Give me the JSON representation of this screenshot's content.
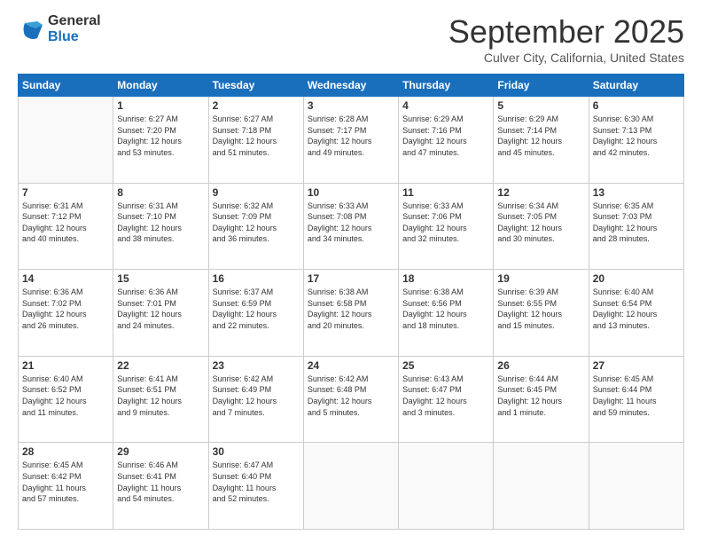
{
  "header": {
    "logo_general": "General",
    "logo_blue": "Blue",
    "month_title": "September 2025",
    "location": "Culver City, California, United States"
  },
  "days_of_week": [
    "Sunday",
    "Monday",
    "Tuesday",
    "Wednesday",
    "Thursday",
    "Friday",
    "Saturday"
  ],
  "weeks": [
    [
      {
        "day": "",
        "info": ""
      },
      {
        "day": "1",
        "info": "Sunrise: 6:27 AM\nSunset: 7:20 PM\nDaylight: 12 hours\nand 53 minutes."
      },
      {
        "day": "2",
        "info": "Sunrise: 6:27 AM\nSunset: 7:18 PM\nDaylight: 12 hours\nand 51 minutes."
      },
      {
        "day": "3",
        "info": "Sunrise: 6:28 AM\nSunset: 7:17 PM\nDaylight: 12 hours\nand 49 minutes."
      },
      {
        "day": "4",
        "info": "Sunrise: 6:29 AM\nSunset: 7:16 PM\nDaylight: 12 hours\nand 47 minutes."
      },
      {
        "day": "5",
        "info": "Sunrise: 6:29 AM\nSunset: 7:14 PM\nDaylight: 12 hours\nand 45 minutes."
      },
      {
        "day": "6",
        "info": "Sunrise: 6:30 AM\nSunset: 7:13 PM\nDaylight: 12 hours\nand 42 minutes."
      }
    ],
    [
      {
        "day": "7",
        "info": "Sunrise: 6:31 AM\nSunset: 7:12 PM\nDaylight: 12 hours\nand 40 minutes."
      },
      {
        "day": "8",
        "info": "Sunrise: 6:31 AM\nSunset: 7:10 PM\nDaylight: 12 hours\nand 38 minutes."
      },
      {
        "day": "9",
        "info": "Sunrise: 6:32 AM\nSunset: 7:09 PM\nDaylight: 12 hours\nand 36 minutes."
      },
      {
        "day": "10",
        "info": "Sunrise: 6:33 AM\nSunset: 7:08 PM\nDaylight: 12 hours\nand 34 minutes."
      },
      {
        "day": "11",
        "info": "Sunrise: 6:33 AM\nSunset: 7:06 PM\nDaylight: 12 hours\nand 32 minutes."
      },
      {
        "day": "12",
        "info": "Sunrise: 6:34 AM\nSunset: 7:05 PM\nDaylight: 12 hours\nand 30 minutes."
      },
      {
        "day": "13",
        "info": "Sunrise: 6:35 AM\nSunset: 7:03 PM\nDaylight: 12 hours\nand 28 minutes."
      }
    ],
    [
      {
        "day": "14",
        "info": "Sunrise: 6:36 AM\nSunset: 7:02 PM\nDaylight: 12 hours\nand 26 minutes."
      },
      {
        "day": "15",
        "info": "Sunrise: 6:36 AM\nSunset: 7:01 PM\nDaylight: 12 hours\nand 24 minutes."
      },
      {
        "day": "16",
        "info": "Sunrise: 6:37 AM\nSunset: 6:59 PM\nDaylight: 12 hours\nand 22 minutes."
      },
      {
        "day": "17",
        "info": "Sunrise: 6:38 AM\nSunset: 6:58 PM\nDaylight: 12 hours\nand 20 minutes."
      },
      {
        "day": "18",
        "info": "Sunrise: 6:38 AM\nSunset: 6:56 PM\nDaylight: 12 hours\nand 18 minutes."
      },
      {
        "day": "19",
        "info": "Sunrise: 6:39 AM\nSunset: 6:55 PM\nDaylight: 12 hours\nand 15 minutes."
      },
      {
        "day": "20",
        "info": "Sunrise: 6:40 AM\nSunset: 6:54 PM\nDaylight: 12 hours\nand 13 minutes."
      }
    ],
    [
      {
        "day": "21",
        "info": "Sunrise: 6:40 AM\nSunset: 6:52 PM\nDaylight: 12 hours\nand 11 minutes."
      },
      {
        "day": "22",
        "info": "Sunrise: 6:41 AM\nSunset: 6:51 PM\nDaylight: 12 hours\nand 9 minutes."
      },
      {
        "day": "23",
        "info": "Sunrise: 6:42 AM\nSunset: 6:49 PM\nDaylight: 12 hours\nand 7 minutes."
      },
      {
        "day": "24",
        "info": "Sunrise: 6:42 AM\nSunset: 6:48 PM\nDaylight: 12 hours\nand 5 minutes."
      },
      {
        "day": "25",
        "info": "Sunrise: 6:43 AM\nSunset: 6:47 PM\nDaylight: 12 hours\nand 3 minutes."
      },
      {
        "day": "26",
        "info": "Sunrise: 6:44 AM\nSunset: 6:45 PM\nDaylight: 12 hours\nand 1 minute."
      },
      {
        "day": "27",
        "info": "Sunrise: 6:45 AM\nSunset: 6:44 PM\nDaylight: 11 hours\nand 59 minutes."
      }
    ],
    [
      {
        "day": "28",
        "info": "Sunrise: 6:45 AM\nSunset: 6:42 PM\nDaylight: 11 hours\nand 57 minutes."
      },
      {
        "day": "29",
        "info": "Sunrise: 6:46 AM\nSunset: 6:41 PM\nDaylight: 11 hours\nand 54 minutes."
      },
      {
        "day": "30",
        "info": "Sunrise: 6:47 AM\nSunset: 6:40 PM\nDaylight: 11 hours\nand 52 minutes."
      },
      {
        "day": "",
        "info": ""
      },
      {
        "day": "",
        "info": ""
      },
      {
        "day": "",
        "info": ""
      },
      {
        "day": "",
        "info": ""
      }
    ]
  ]
}
